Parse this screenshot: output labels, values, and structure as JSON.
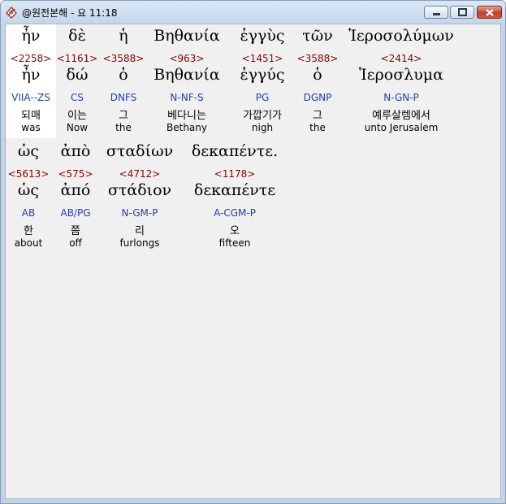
{
  "window": {
    "title": "@원전본해 - 요 11:18"
  },
  "verse_rows": [
    {
      "words": [
        {
          "greek": "ἦν",
          "strong": "<2258>",
          "lemma": "ἦν",
          "parse": "VIIA--ZS",
          "korean": "되매",
          "english": "was",
          "highlighted": true
        },
        {
          "greek": "δὲ",
          "strong": "<1161>",
          "lemma": "δώ",
          "parse": "CS",
          "korean": "이는",
          "english": "Now"
        },
        {
          "greek": "ἡ",
          "strong": "<3588>",
          "lemma": "ὁ",
          "parse": "DNFS",
          "korean": "그",
          "english": "the"
        },
        {
          "greek": "Βηθανία",
          "strong": "<963>",
          "lemma": "Βηθανία",
          "parse": "N-NF-S",
          "korean": "베다니는",
          "english": "Bethany"
        },
        {
          "greek": "ἐγγὺς",
          "strong": "<1451>",
          "lemma": "ἐγγύς",
          "parse": "PG",
          "korean": "가깝기가",
          "english": "nigh"
        },
        {
          "greek": "τῶν",
          "strong": "<3588>",
          "lemma": "ὁ",
          "parse": "DGNP",
          "korean": "그",
          "english": "the"
        },
        {
          "greek": "Ἱεροσολύμων",
          "strong": "<2414>",
          "lemma": "Ἱεροσλυμα",
          "parse": "N-GN-P",
          "korean": "예루살렘에서",
          "english": "unto Jerusalem"
        }
      ]
    },
    {
      "words": [
        {
          "greek": "ὡς",
          "strong": "<5613>",
          "lemma": "ὡς",
          "parse": "AB",
          "korean": "한",
          "english": "about"
        },
        {
          "greek": "ἀπὸ",
          "strong": "<575>",
          "lemma": "ἀπό",
          "parse": "AB/PG",
          "korean": "쯤",
          "english": "off"
        },
        {
          "greek": "σταδίων",
          "strong": "<4712>",
          "lemma": "στάδιον",
          "parse": "N-GM-P",
          "korean": "리",
          "english": "furlongs"
        },
        {
          "greek": "δεκαπέντε.",
          "strong": "<1178>",
          "lemma": "δεκαπέντε",
          "parse": "A-CGM-P",
          "korean": "오",
          "english": "fifteen"
        }
      ]
    }
  ],
  "icons": {
    "app": "bible-app-icon",
    "minimize": "minimize-icon",
    "maximize": "maximize-icon",
    "close": "close-icon"
  },
  "colors": {
    "strong_number": "#8b0000",
    "parse_code": "#1f3fb0",
    "highlight": "#ffffff"
  }
}
